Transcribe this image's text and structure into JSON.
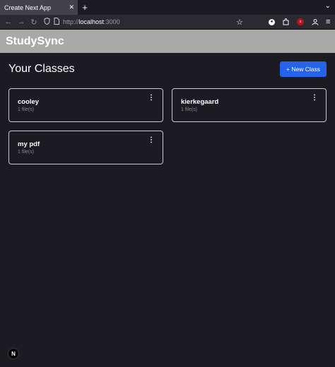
{
  "browser": {
    "tab_title": "Create Next App",
    "tab_close": "✕",
    "new_tab": "+",
    "overflow": "⌄",
    "url_scheme": "http://",
    "url_host": "localhost",
    "url_port": ":3000"
  },
  "app": {
    "brand": "StudySync",
    "page_title": "Your Classes",
    "new_class_label": "+ New Class"
  },
  "classes": [
    {
      "name": "cooley",
      "files": "1 file(s)"
    },
    {
      "name": "kierkegaard",
      "files": "1 file(s)"
    },
    {
      "name": "my pdf",
      "files": "1 file(s)"
    }
  ],
  "card_menu_glyph": "⋮",
  "next_badge": "N"
}
